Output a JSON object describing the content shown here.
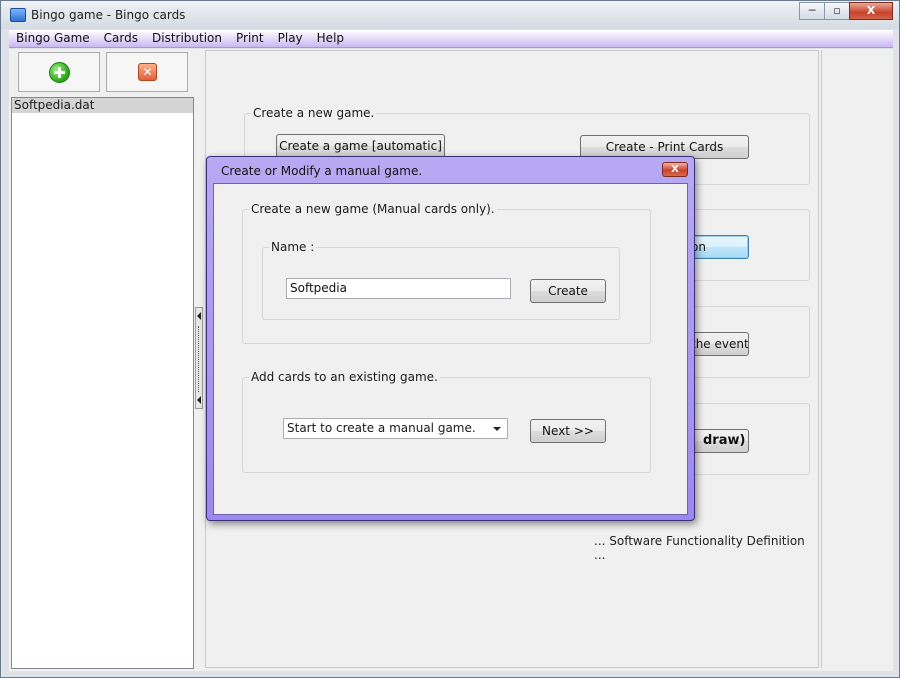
{
  "window": {
    "title": "Bingo game - Bingo cards",
    "minimize": "─",
    "maximize": "▫",
    "close": "X"
  },
  "menu": [
    "Bingo Game",
    "Cards",
    "Distribution",
    "Print",
    "Play",
    "Help"
  ],
  "toolbar": {
    "add_icon": "add-icon",
    "delete_icon": "delete-icon"
  },
  "file_list": [
    "Softpedia.dat"
  ],
  "main": {
    "group1_label": "Create a new game.",
    "create_auto_label": "Create a game [automatic]",
    "create_print_label": "Create - Print Cards",
    "partial_btn2": "on",
    "partial_btn3": "the event",
    "partial_btn4": "draw)",
    "footer": "... Software Functionality Definition ..."
  },
  "dialog": {
    "title": "Create or Modify a manual game.",
    "close": "X",
    "group_new_label": "Create a new game (Manual cards only).",
    "name_label": "Name :",
    "name_value": "Softpedia",
    "create_label": "Create",
    "group_add_label": "Add cards to an existing game.",
    "combo_value": "Start to create a manual game.",
    "next_label": "Next >>"
  }
}
